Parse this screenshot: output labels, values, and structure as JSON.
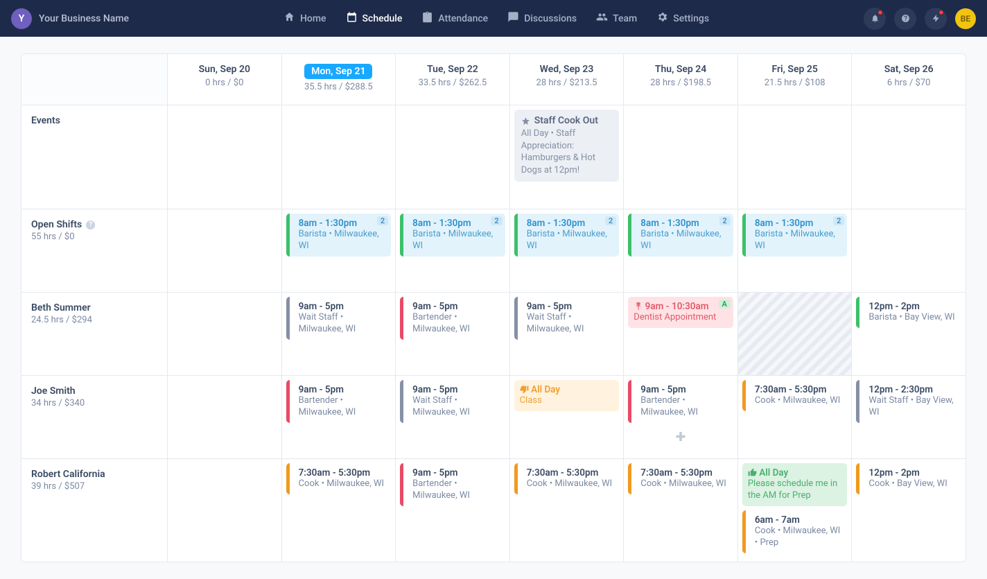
{
  "brand": {
    "initial": "Y",
    "name": "Your Business Name"
  },
  "nav": {
    "home": "Home",
    "schedule": "Schedule",
    "attendance": "Attendance",
    "discussions": "Discussions",
    "team": "Team",
    "settings": "Settings"
  },
  "user": {
    "initials": "BE"
  },
  "days": [
    {
      "label": "Sun, Sep 20",
      "stats": "0 hrs / $0",
      "active": false
    },
    {
      "label": "Mon, Sep 21",
      "stats": "35.5 hrs / $288.5",
      "active": true
    },
    {
      "label": "Tue, Sep 22",
      "stats": "33.5 hrs / $262.5",
      "active": false
    },
    {
      "label": "Wed, Sep 23",
      "stats": "28 hrs / $213.5",
      "active": false
    },
    {
      "label": "Thu, Sep 24",
      "stats": "28 hrs / $198.5",
      "active": false
    },
    {
      "label": "Fri, Sep 25",
      "stats": "21.5 hrs / $108",
      "active": false
    },
    {
      "label": "Sat, Sep 26",
      "stats": "6 hrs / $70",
      "active": false
    }
  ],
  "rows": {
    "events": {
      "title": "Events",
      "wed": {
        "title": "Staff Cook Out",
        "detail": "All Day • Staff Appreciation: Hamburgers & Hot Dogs at 12pm!"
      }
    },
    "openshifts": {
      "title": "Open Shifts",
      "sub": "55 hrs / $0",
      "card": {
        "time": "8am - 1:30pm",
        "detail": "Barista • Milwaukee, WI",
        "badge": "2"
      }
    },
    "beth": {
      "title": "Beth Summer",
      "sub": "24.5 hrs / $294",
      "mon": {
        "time": "9am - 5pm",
        "detail": "Wait Staff • Milwaukee, WI",
        "color": "#8590a6"
      },
      "tue": {
        "time": "9am - 5pm",
        "detail": "Bartender • Milwaukee, WI",
        "color": "#e84a67"
      },
      "wed": {
        "time": "9am - 5pm",
        "detail": "Wait Staff • Milwaukee, WI",
        "color": "#8590a6"
      },
      "thu": {
        "time": "9am - 10:30am",
        "detail": "Dentist Appointment",
        "badge": "A"
      },
      "sat": {
        "time": "12pm - 2pm",
        "detail": "Barista • Bay View, WI",
        "color": "#3cc06a"
      }
    },
    "joe": {
      "title": "Joe Smith",
      "sub": "34 hrs / $340",
      "mon": {
        "time": "9am - 5pm",
        "detail": "Bartender • Milwaukee, WI",
        "color": "#e84a67"
      },
      "tue": {
        "time": "9am - 5pm",
        "detail": "Wait Staff • Milwaukee, WI",
        "color": "#8590a6"
      },
      "wed": {
        "time": "All Day",
        "detail": "Class"
      },
      "thu": {
        "time": "9am - 5pm",
        "detail": "Bartender • Milwaukee, WI",
        "color": "#e84a67"
      },
      "fri": {
        "time": "7:30am - 5:30pm",
        "detail": "Cook • Milwaukee, WI",
        "color": "#f09a1f"
      },
      "sat": {
        "time": "12pm - 2:30pm",
        "detail": "Wait Staff • Bay View, WI",
        "color": "#8590a6"
      }
    },
    "robert": {
      "title": "Robert California",
      "sub": "39 hrs / $507",
      "mon": {
        "time": "7:30am - 5:30pm",
        "detail": "Cook • Milwaukee, WI",
        "color": "#f09a1f"
      },
      "tue": {
        "time": "9am - 5pm",
        "detail": "Bartender • Milwaukee, WI",
        "color": "#e84a67"
      },
      "wed": {
        "time": "7:30am - 5:30pm",
        "detail": "Cook • Milwaukee, WI",
        "color": "#f09a1f"
      },
      "thu": {
        "time": "7:30am - 5:30pm",
        "detail": "Cook • Milwaukee, WI",
        "color": "#f09a1f"
      },
      "fri_pref": {
        "time": "All Day",
        "detail": "Please schedule me in the AM for Prep"
      },
      "fri_shift": {
        "time": "6am - 7am",
        "detail": "Cook • Milwaukee, WI • Prep",
        "color": "#f09a1f"
      },
      "sat": {
        "time": "12pm - 2pm",
        "detail": "Cook • Bay View, WI",
        "color": "#f09a1f"
      }
    }
  },
  "colors": {
    "openshift_stripe": "#3cc06a"
  }
}
